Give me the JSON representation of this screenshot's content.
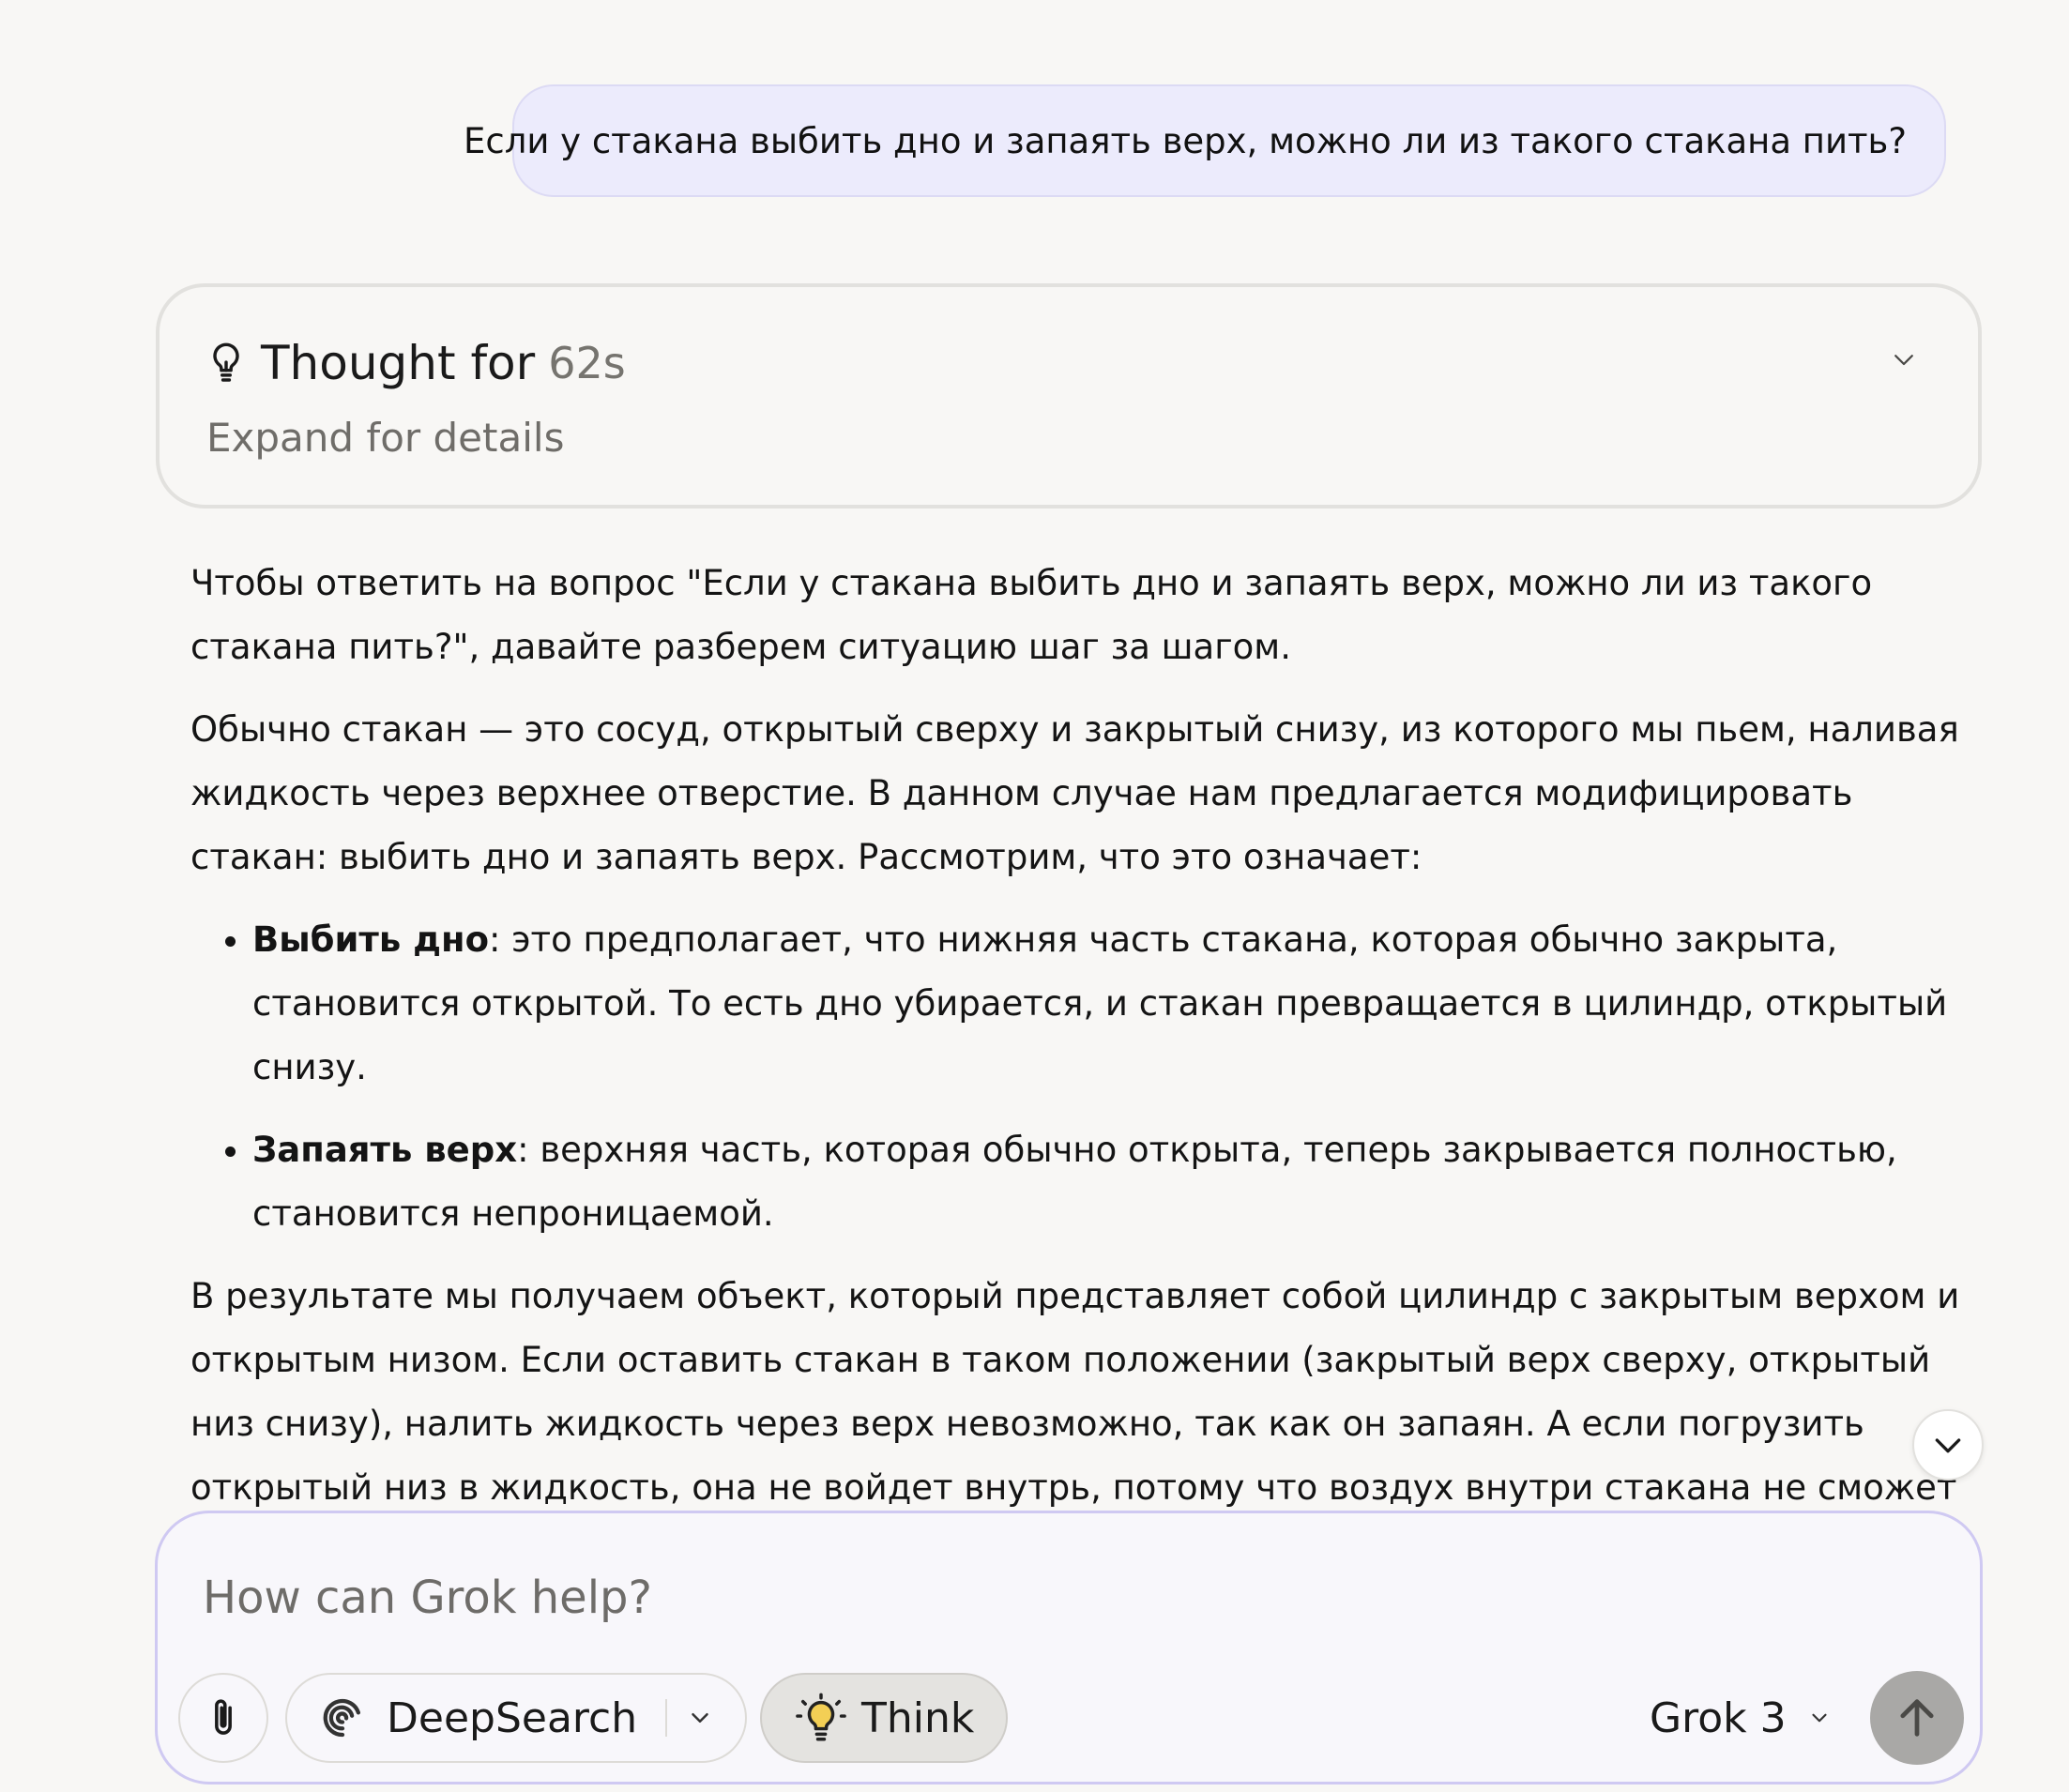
{
  "conversation": {
    "user_message": "Если у стакана выбить дно и запаять верх, можно ли из такого стакана пить?",
    "thought": {
      "title": "Thought for",
      "duration": "62s",
      "subtitle": "Expand for details",
      "icon": "lightbulb-icon",
      "toggle_icon": "chevron-down-icon"
    },
    "answer": {
      "p1": "Чтобы ответить на вопрос \"Если у стакана выбить дно и запаять верх, можно ли из такого стакана пить?\", давайте разберем ситуацию шаг за шагом.",
      "p2": "Обычно стакан — это сосуд, открытый сверху и закрытый снизу, из которого мы пьем, наливая жидкость через верхнее отверстие. В данном случае нам предлагается модифицировать стакан: выбить дно и запаять верх. Рассмотрим, что это означает:",
      "bullets": [
        {
          "term": "Выбить дно",
          "text": ": это предполагает, что нижняя часть стакана, которая обычно закрыта, становится открытой. То есть дно убирается, и стакан превращается в цилиндр, открытый снизу."
        },
        {
          "term": "Запаять верх",
          "text": ": верхняя часть, которая обычно открыта, теперь закрывается полностью, становится непроницаемой."
        }
      ],
      "p3": "В результате мы получаем объект, который представляет собой цилиндр с закрытым верхом и открытым низом. Если оставить стакан в таком положении (закрытый верх сверху, открытый низ снизу), налить жидкость через верх невозможно, так как он запаян. А если погрузить открытый низ в жидкость, она не войдет внутрь, потому что воздух внутри стакана не сможет выйти из-за запаянного верха. Таким образом, в стандартной ориентации пить из такого стакана нельзя."
    }
  },
  "composer": {
    "placeholder": "How can Grok help?",
    "attach_icon": "paperclip-icon",
    "deepsearch_label": "DeepSearch",
    "deepsearch_icon": "deepsearch-swirl-icon",
    "think_label": "Think",
    "think_icon": "lightbulb-icon",
    "think_active": true,
    "model_label": "Grok 3",
    "send_icon": "arrow-up-icon"
  },
  "colors": {
    "background": "#f8f7f5",
    "user_bubble": "#ecebfc",
    "composer_border": "#cfc9f2",
    "send_button": "#a9a8a6"
  }
}
